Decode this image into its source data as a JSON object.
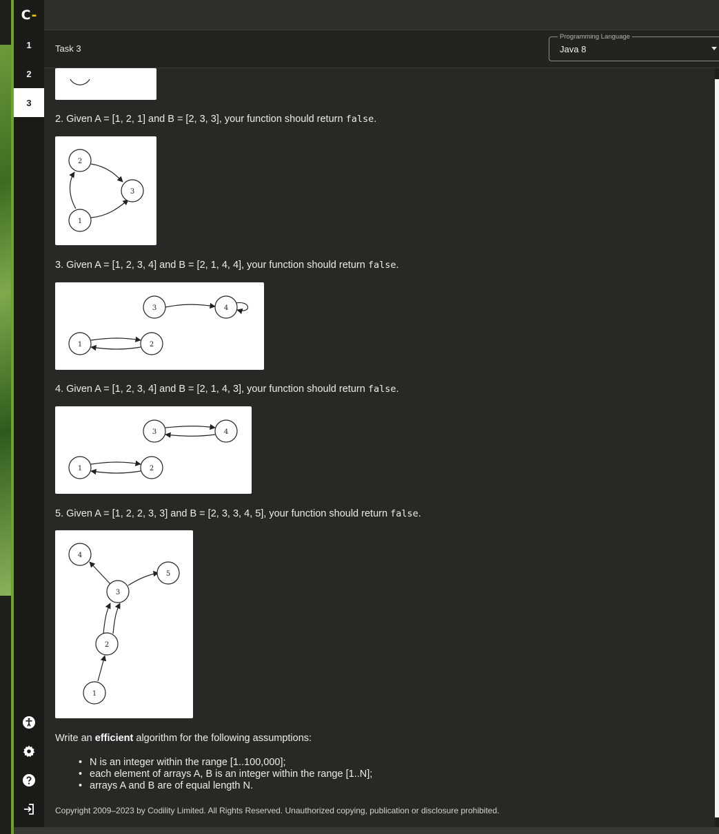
{
  "app": {
    "logo_letter": "C",
    "logo_dash": "-"
  },
  "nav": {
    "items": [
      "1",
      "2",
      "3"
    ],
    "active": "3"
  },
  "header": {
    "task_title": "Task 3",
    "language_legend": "Programming Language",
    "language_value": "Java 8"
  },
  "icons": {
    "accessibility": "accessibility-icon",
    "settings": "gear-icon",
    "help": "help-icon",
    "logout": "logout-icon",
    "dropdown": "chevron-down-icon"
  },
  "examples": [
    {
      "prefix": "2. Given A = [1, 2, 1] and B = [2, 3, 3], your function should return ",
      "code": "false",
      "suffix": "."
    },
    {
      "prefix": "3. Given A = [1, 2, 3, 4] and B = [2, 1, 4, 4], your function should return ",
      "code": "false",
      "suffix": "."
    },
    {
      "prefix": "4. Given A = [1, 2, 3, 4] and B = [2, 1, 4, 3], your function should return ",
      "code": "false",
      "suffix": "."
    },
    {
      "prefix": "5. Given A = [1, 2, 2, 3, 3] and B = [2, 3, 3, 4, 5], your function should return ",
      "code": "false",
      "suffix": "."
    }
  ],
  "diagram_labels": {
    "d2": [
      "1",
      "2",
      "3"
    ],
    "d3": [
      "1",
      "2",
      "3",
      "4"
    ],
    "d4": [
      "1",
      "2",
      "3",
      "4"
    ],
    "d5": [
      "1",
      "2",
      "3",
      "4",
      "5"
    ]
  },
  "assumptions": {
    "intro_before": "Write an ",
    "intro_bold": "efficient",
    "intro_after": " algorithm for the following assumptions:",
    "items": [
      "N is an integer within the range [1..100,000];",
      "each element of arrays A, B is an integer within the range [1..N];",
      "arrays A and B are of equal length N."
    ]
  },
  "footer": {
    "copyright": "Copyright 2009–2023 by Codility Limited. All Rights Reserved. Unauthorized copying, publication or disclosure prohibited."
  },
  "colors": {
    "accent": "#6aa52a",
    "logo_dash": "#f2c200",
    "background": "#282824"
  }
}
